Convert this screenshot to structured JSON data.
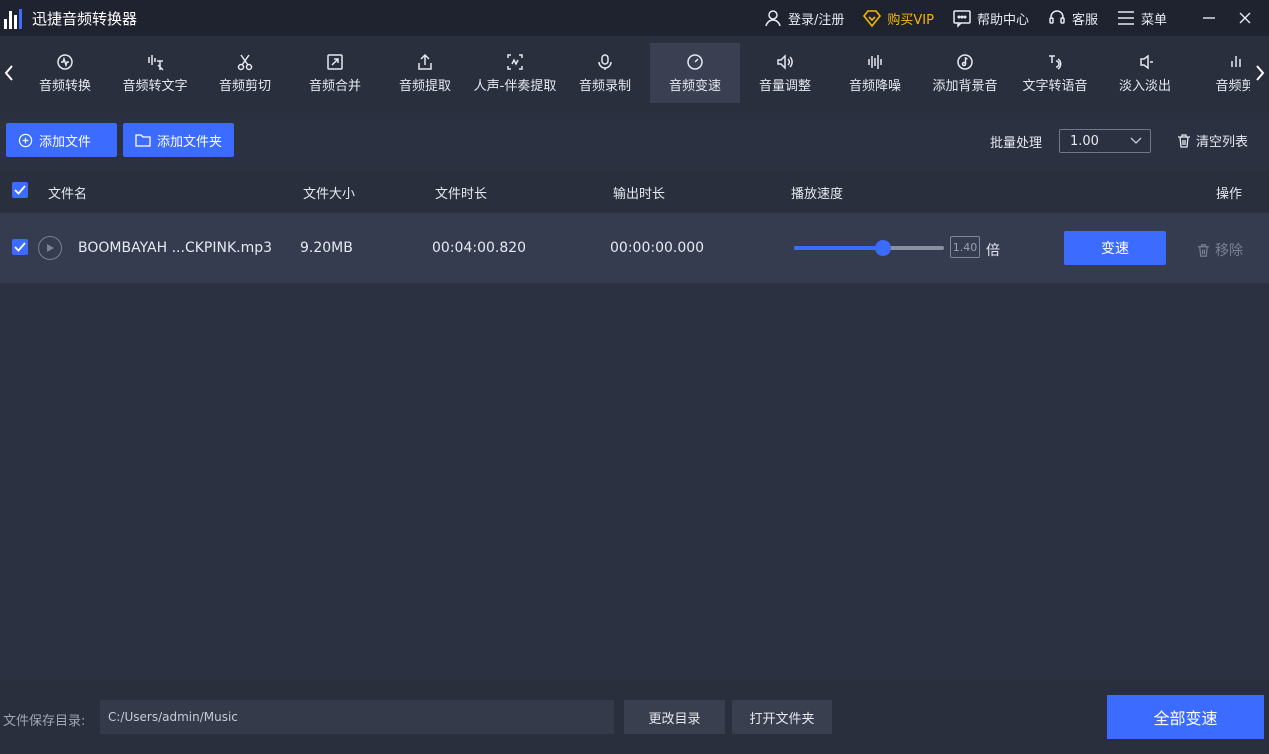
{
  "app": {
    "title": "迅捷音频转换器"
  },
  "header": {
    "login": "登录/注册",
    "vip": "购买VIP",
    "help": "帮助中心",
    "service": "客服",
    "menu": "菜单"
  },
  "tools": [
    {
      "label": "音频转换",
      "icon": "convert-icon"
    },
    {
      "label": "音频转文字",
      "icon": "speech-to-text-icon"
    },
    {
      "label": "音频剪切",
      "icon": "scissors-icon"
    },
    {
      "label": "音频合并",
      "icon": "merge-icon"
    },
    {
      "label": "音频提取",
      "icon": "extract-icon"
    },
    {
      "label": "人声-伴奏提取",
      "icon": "vocal-icon"
    },
    {
      "label": "音频录制",
      "icon": "mic-icon"
    },
    {
      "label": "音频变速",
      "icon": "speed-icon",
      "active": true
    },
    {
      "label": "音量调整",
      "icon": "volume-icon"
    },
    {
      "label": "音频降噪",
      "icon": "denoise-icon"
    },
    {
      "label": "添加背景音",
      "icon": "music-disc-icon"
    },
    {
      "label": "文字转语音",
      "icon": "text-to-speech-icon"
    },
    {
      "label": "淡入淡出",
      "icon": "fade-icon"
    },
    {
      "label": "音频剪",
      "icon": "bars-icon"
    }
  ],
  "toolbar": {
    "add_file": "添加文件",
    "add_folder": "添加文件夹",
    "batch_label": "批量处理",
    "batch_value": "1.00",
    "clear_list": "清空列表"
  },
  "table": {
    "headers": {
      "name": "文件名",
      "size": "文件大小",
      "duration": "文件时长",
      "output_duration": "输出时长",
      "speed": "播放速度",
      "actions": "操作"
    },
    "rows": [
      {
        "name": "BOOMBAYAH ...CKPINK.mp3",
        "size": "9.20MB",
        "duration": "00:04:00.820",
        "output_duration": "00:00:00.000",
        "speed": "1.40",
        "speed_fraction": 0.59,
        "speed_unit": "倍",
        "action": "变速",
        "remove": "移除"
      }
    ]
  },
  "footer": {
    "save_label": "文件保存目录:",
    "save_path": "C:/Users/admin/Music",
    "change_dir": "更改目录",
    "open_folder": "打开文件夹",
    "convert_all": "全部变速"
  },
  "colors": {
    "accent": "#3b6bff",
    "vip": "#f5b800",
    "background": "#2a2f3e"
  }
}
